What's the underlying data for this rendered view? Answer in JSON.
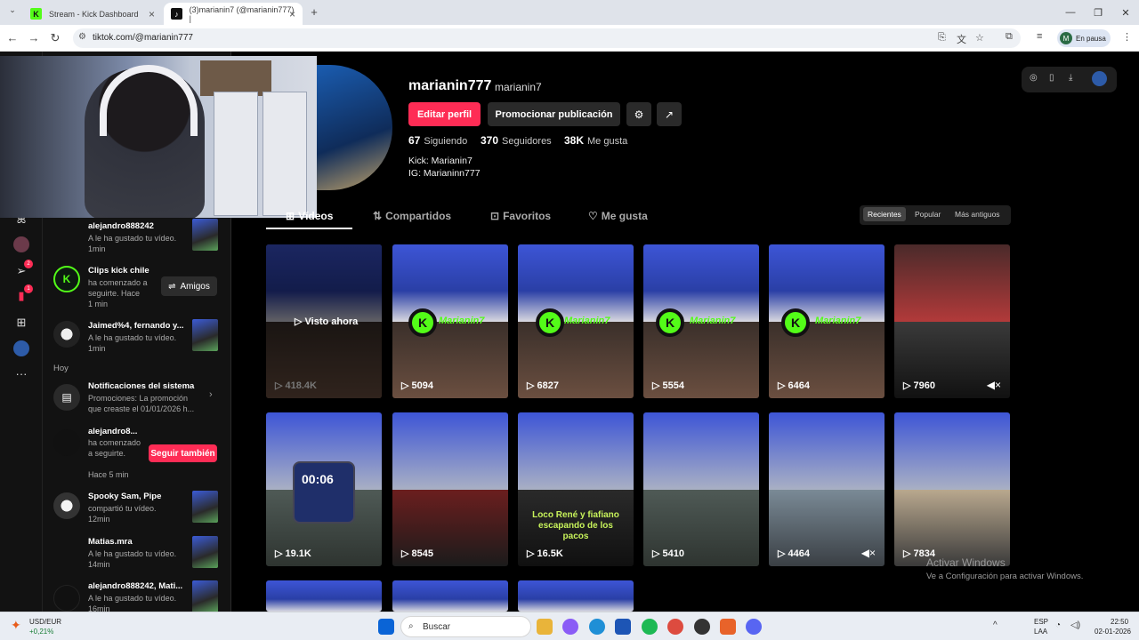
{
  "browser": {
    "tabs": [
      {
        "title": "Stream - Kick Dashboard",
        "favicon": "K"
      },
      {
        "title": "(3)marianin7 (@marianin777) |",
        "favicon": "♪"
      }
    ],
    "new_tab_symbol": "+",
    "url": "tiktok.com/@marianin777",
    "profile_initial": "M",
    "profile_status": "En pausa"
  },
  "notifications": {
    "items": [
      {
        "name": "alejandro888242",
        "text": "A le ha gustado tu vídeo.",
        "time": "1min"
      },
      {
        "name": "Clips kick chile",
        "text": "ha comenzado a seguirte. Hace",
        "time": "1 min",
        "button": "Amigos"
      },
      {
        "name": "Jaimed%4, fernando y...",
        "text": "A le ha gustado tu vídeo.",
        "time": "1min"
      }
    ],
    "section_today": "Hoy",
    "system": {
      "name": "Notificaciones del sistema",
      "text": "Promociones: La promoción que creaste el 01/01/2026 h..."
    },
    "follow": {
      "name": "alejandro8...",
      "text": "ha comenzado a seguirte.",
      "time": "Hace 5 min",
      "button": "Seguir también"
    },
    "more": [
      {
        "name": "Spooky Sam, Pipe",
        "text": "compartió tu vídeo.",
        "time": "12min"
      },
      {
        "name": "Matias.mra",
        "text": "A le ha gustado tu vídeo.",
        "time": "14min"
      },
      {
        "name": "alejandro888242, Mati...",
        "text": "A le ha gustado tu vídeo.",
        "time": "16min"
      }
    ]
  },
  "rail_badges": {
    "messages": "2",
    "inbox": "1"
  },
  "profile": {
    "username": "marianin777",
    "nickname": "marianin7",
    "edit_button": "Editar perfil",
    "promote_button": "Promocionar publicación",
    "following_count": "67",
    "following_label": "Siguiendo",
    "followers_count": "370",
    "followers_label": "Seguidores",
    "likes_count": "38K",
    "likes_label": "Me gusta",
    "bio_line1": "Kick: Marianin7",
    "bio_line2": "IG: Marianinn777"
  },
  "tabs": [
    {
      "label": "Vídeos",
      "icon": "grid-icon"
    },
    {
      "label": "Compartidos",
      "icon": "repost-icon"
    },
    {
      "label": "Favoritos",
      "icon": "bookmark-icon"
    },
    {
      "label": "Me gusta",
      "icon": "heart-icon"
    }
  ],
  "sort": {
    "recent": "Recientes",
    "popular": "Popular",
    "oldest": "Más antiguos"
  },
  "videos_row1": [
    {
      "views": "418.4K",
      "overlay": "Visto ahora"
    },
    {
      "views": "5094",
      "kick": "Marianin7"
    },
    {
      "views": "6827",
      "kick": "Marianin7"
    },
    {
      "views": "5554",
      "kick": "Marianin7"
    },
    {
      "views": "6464",
      "kick": "Marianin7"
    },
    {
      "views": "7960"
    }
  ],
  "videos_row2": [
    {
      "views": "19.1K",
      "clock": "00:06"
    },
    {
      "views": "8545"
    },
    {
      "views": "16.5K",
      "caption": "Loco René y fiafiano escapando de los pacos"
    },
    {
      "views": "5410"
    },
    {
      "views": "4464"
    },
    {
      "views": "7834"
    }
  ],
  "windows": {
    "activate_title": "Activar Windows",
    "activate_text": "Ve a Configuración para activar Windows."
  },
  "taskbar": {
    "currency": "USD/EUR",
    "change": "+0,21%",
    "search": "Buscar",
    "lang": "ESP",
    "lang2": "LAA",
    "time": "22:50",
    "date": "02-01-2026"
  }
}
